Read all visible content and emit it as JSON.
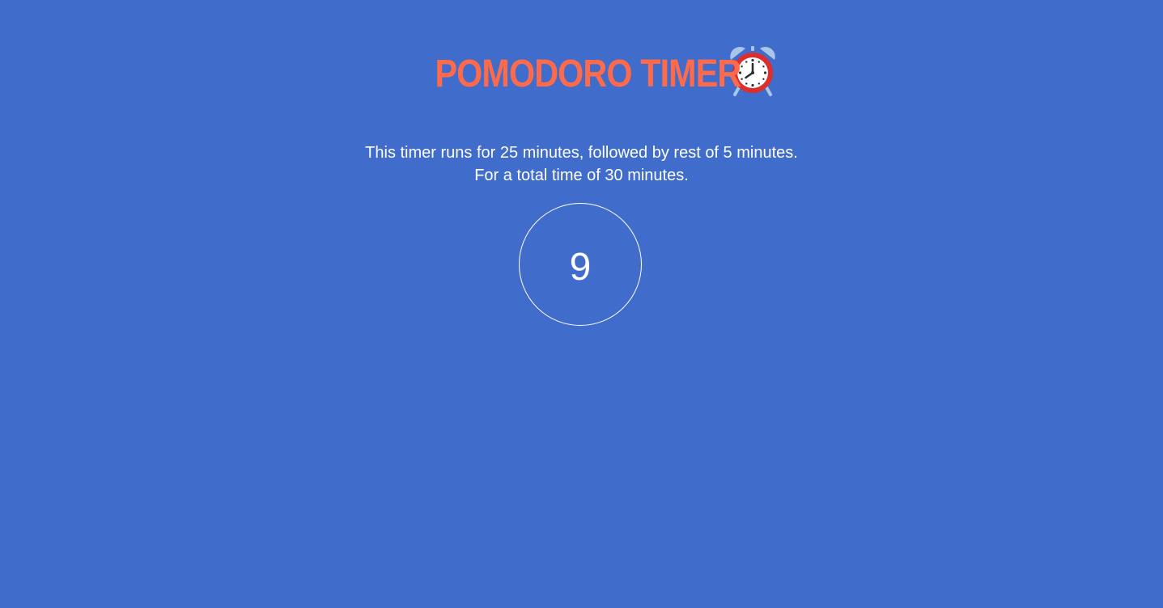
{
  "header": {
    "title": "POMODORO TIMER",
    "title_icon": "alarm-clock-icon",
    "title_color": "#ff6b4a"
  },
  "description": {
    "line1": "This timer runs for 25 minutes, followed by rest of 5 minutes.",
    "line2": "For a total time of 30 minutes."
  },
  "timer": {
    "value": "9"
  },
  "colors": {
    "background": "#406ccc",
    "text": "#ffffff",
    "clock_body": "#dd2e2e",
    "clock_bells": "#a9c6e8"
  }
}
